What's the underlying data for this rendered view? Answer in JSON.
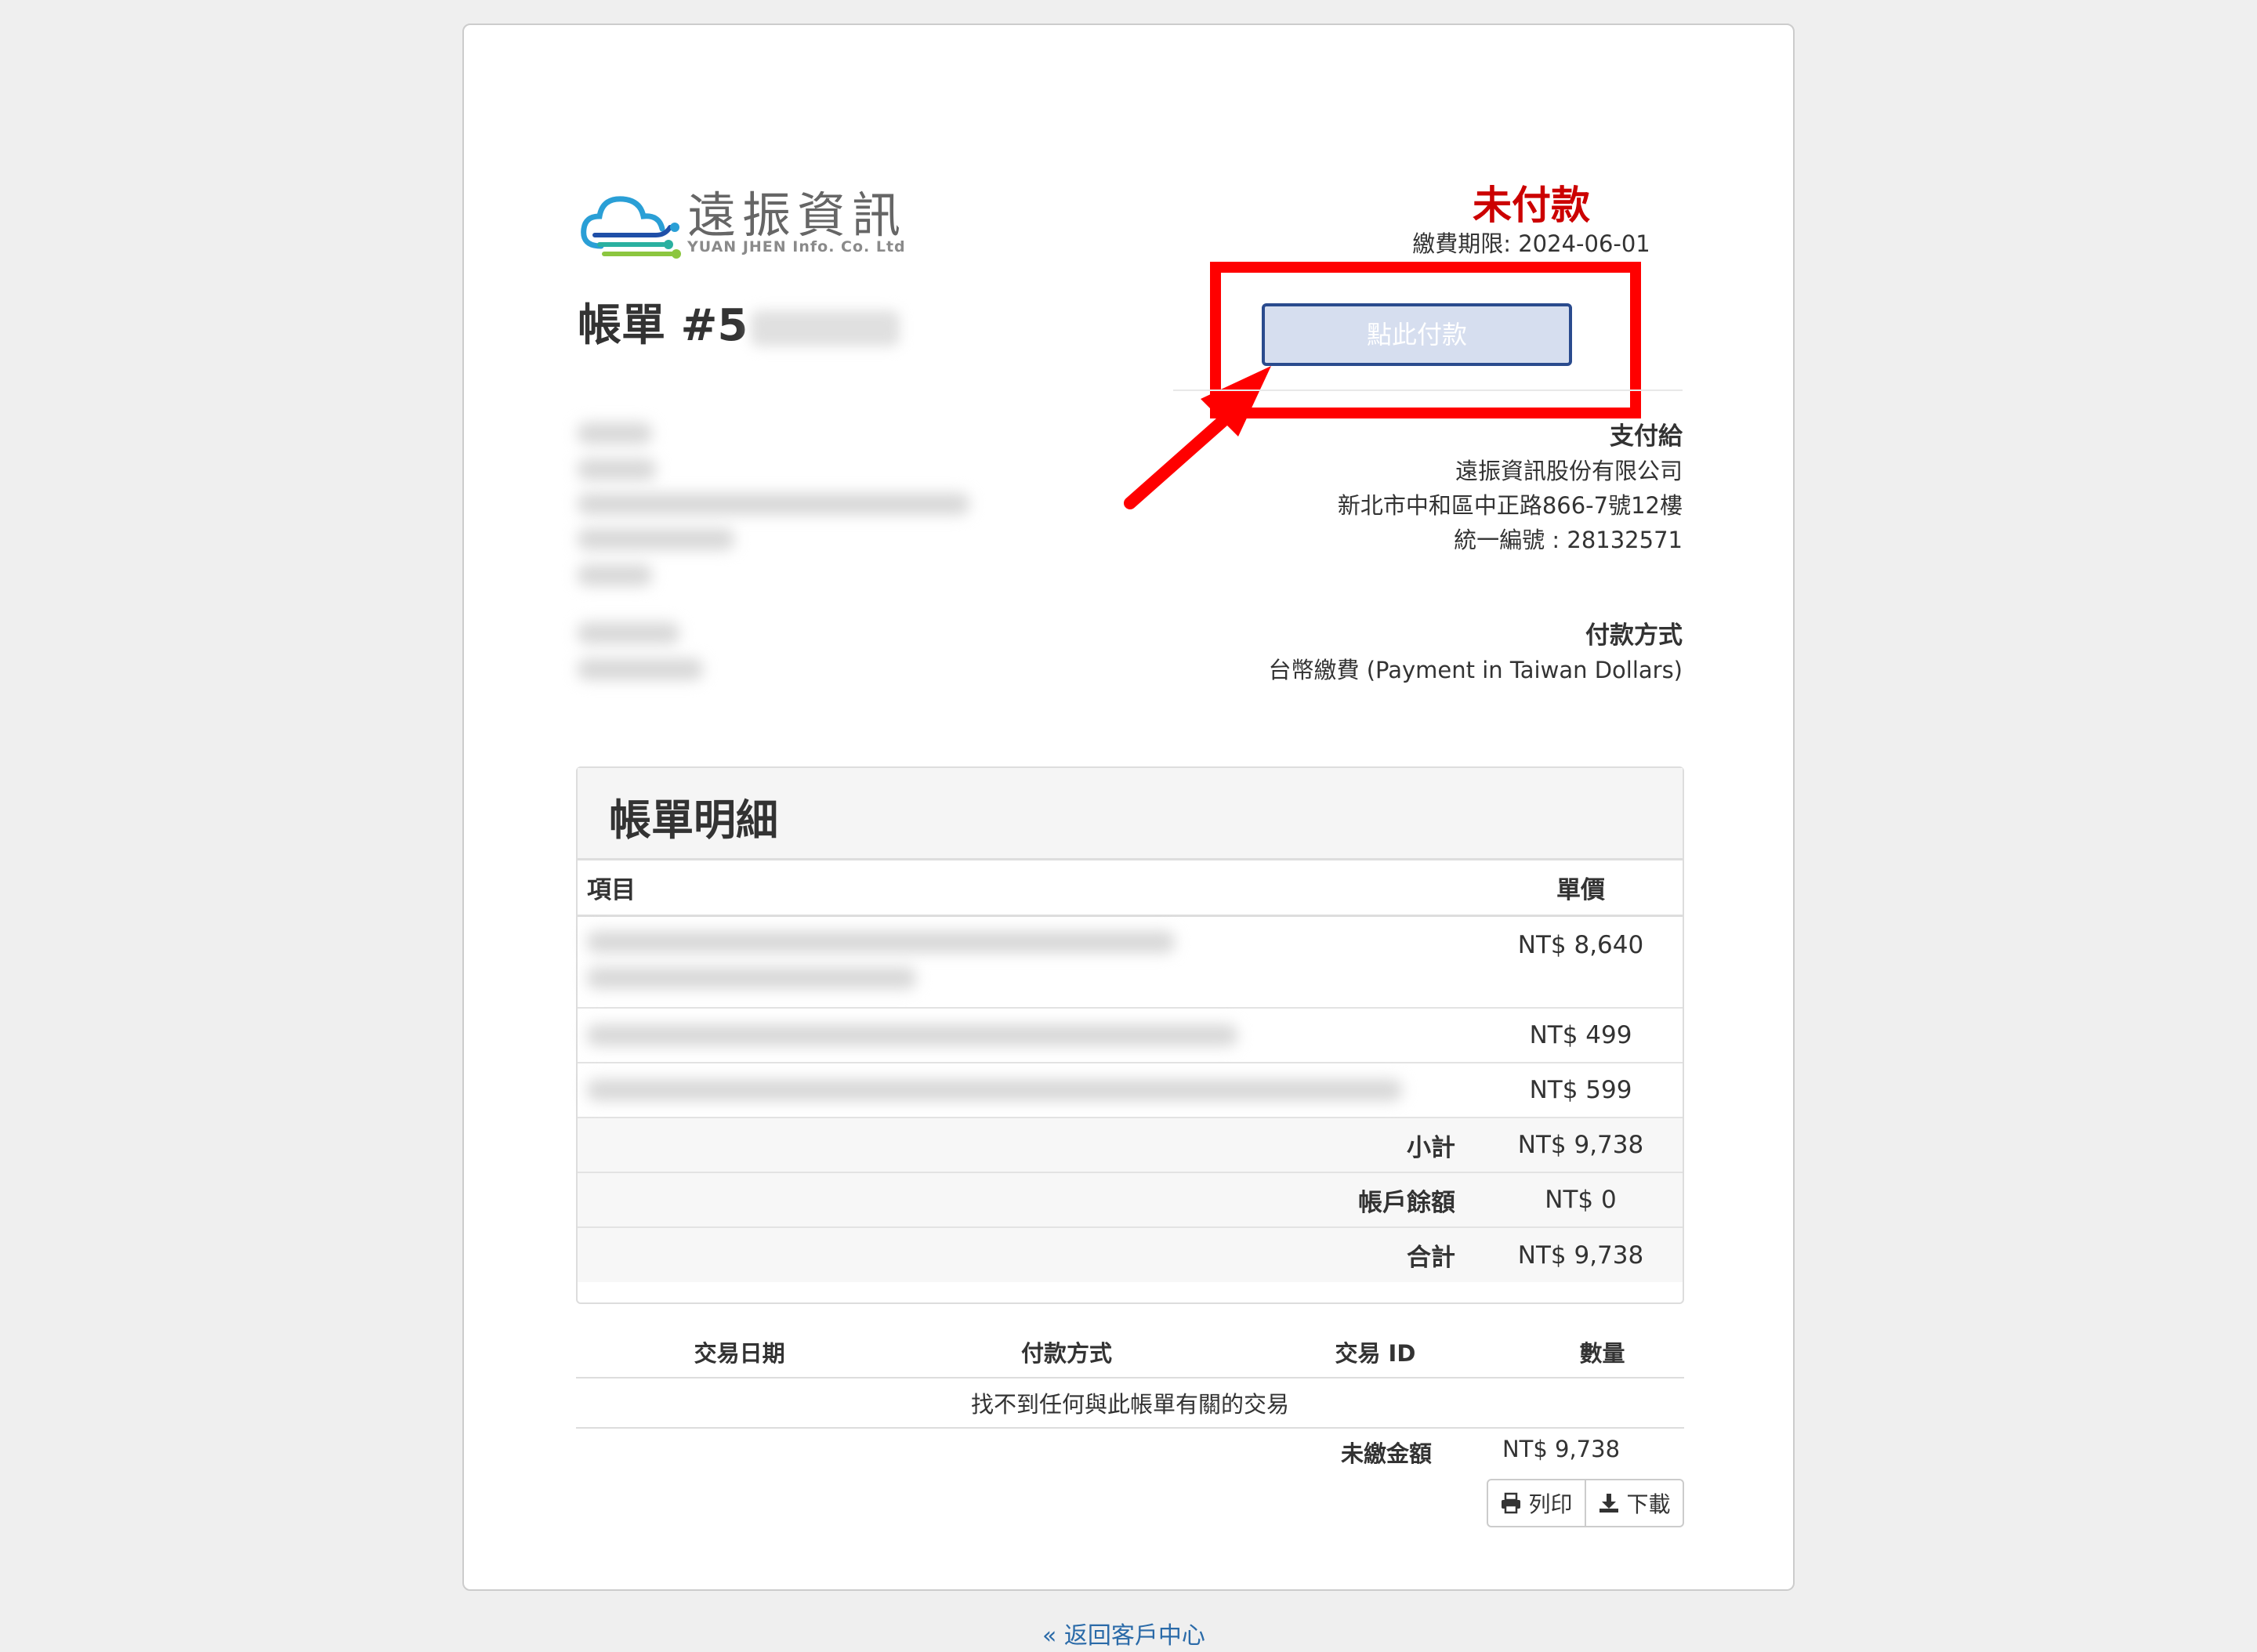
{
  "logo": {
    "name_zh": "遠振資訊",
    "name_en": "YUAN JHEN Info. Co. Ltd"
  },
  "invoice": {
    "title_prefix": "帳單 #5"
  },
  "status": {
    "label": "未付款",
    "due": "繳費期限: 2024-06-01",
    "status_color": "#cc0000"
  },
  "pay_button": {
    "label": "點此付款"
  },
  "pay_to": {
    "heading": "支付給",
    "company": "遠振資訊股份有限公司",
    "address": "新北市中和區中正路866-7號12樓",
    "tax_id": "統一編號 : 28132571"
  },
  "payment_method": {
    "heading": "付款方式",
    "value": "台幣繳費 (Payment in Taiwan Dollars)"
  },
  "details": {
    "title": "帳單明細",
    "headers": {
      "item": "項目",
      "price": "單價"
    },
    "items": [
      {
        "price": "NT$ 8,640"
      },
      {
        "price": "NT$ 499"
      },
      {
        "price": "NT$ 599"
      }
    ],
    "subtotal": {
      "label": "小計",
      "value": "NT$ 9,738"
    },
    "credit": {
      "label": "帳戶餘額",
      "value": "NT$ 0"
    },
    "total": {
      "label": "合計",
      "value": "NT$ 9,738"
    }
  },
  "transactions": {
    "headers": {
      "date": "交易日期",
      "method": "付款方式",
      "id": "交易 ID",
      "amount": "數量"
    },
    "empty": "找不到任何與此帳單有關的交易",
    "balance_label": "未繳金額",
    "balance_value": "NT$ 9,738"
  },
  "actions": {
    "print": "列印",
    "download": "下載"
  },
  "back_link": "« 返回客戶中心",
  "colors": {
    "highlight": "#ff0000",
    "button_border": "#2a4b8e",
    "link": "#2a6aa8"
  }
}
